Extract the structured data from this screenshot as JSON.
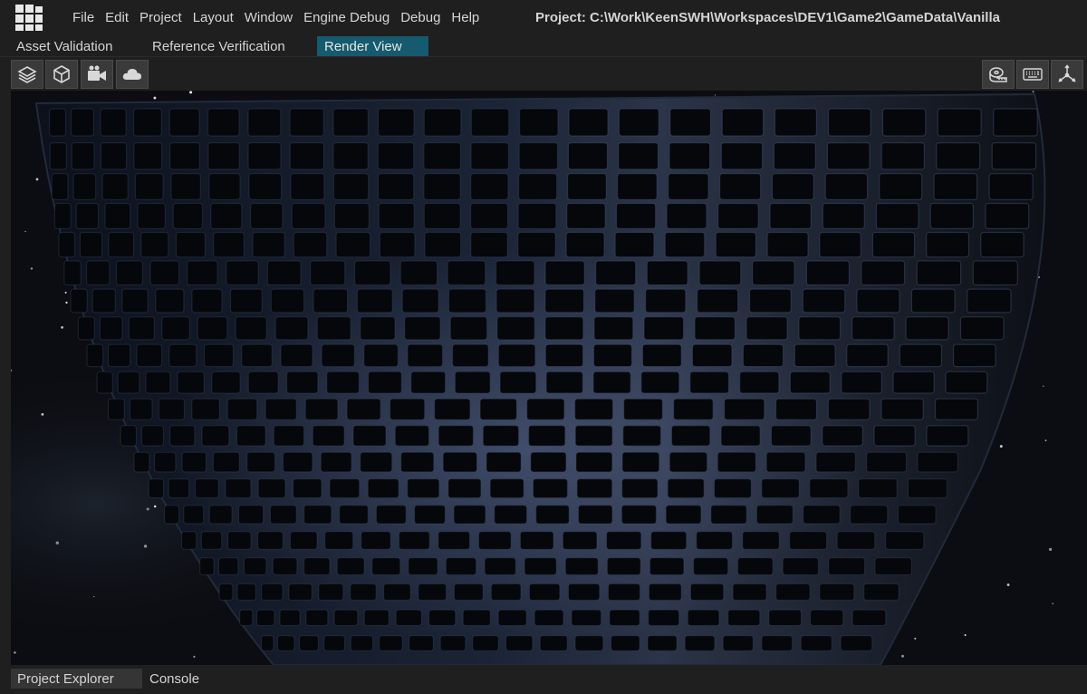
{
  "menubar": {
    "logo_icon": "app-logo-icon",
    "items": [
      "File",
      "Edit",
      "Project",
      "Layout",
      "Window",
      "Engine Debug",
      "Debug",
      "Help"
    ],
    "project_path": "Project: C:\\Work\\KeenSWH\\Workspaces\\DEV1\\Game2\\GameData\\Vanilla"
  },
  "tabs": {
    "items": [
      "Asset Validation",
      "Reference Verification",
      "Render View"
    ],
    "active": "Render View"
  },
  "toolbar": {
    "left_icons": [
      "layers-icon",
      "cube-icon",
      "camera-icon",
      "cloud-icon"
    ],
    "right_icons": [
      "measure-tape-icon",
      "keyboard-icon",
      "axis-gizmo-icon"
    ]
  },
  "bottom_tabs": {
    "items": [
      "Project Explorer",
      "Console"
    ],
    "active": "Project Explorer"
  },
  "colors": {
    "background": "#1f1f1f",
    "active_tab": "#155a6e",
    "viewport": "#0b0d12"
  }
}
